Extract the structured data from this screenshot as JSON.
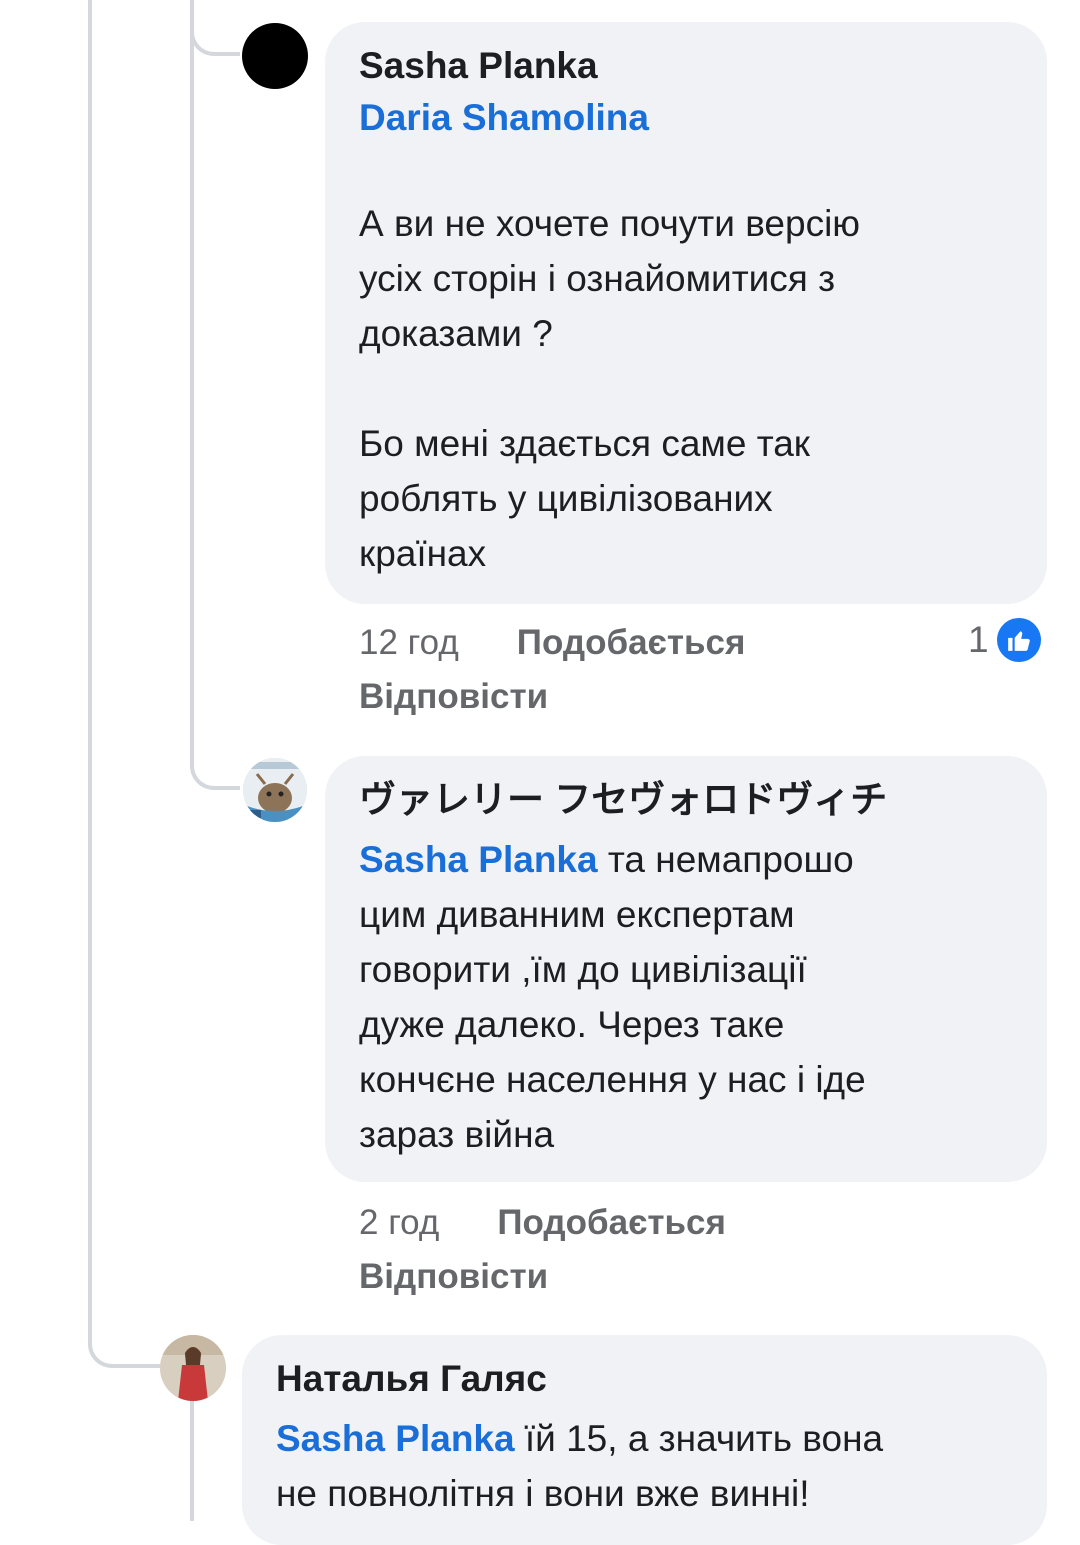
{
  "comments": [
    {
      "author": "Sasha Planka",
      "tag": "Daria Shamolina",
      "paragraph1": "А ви не хочете почути версію\nусіх сторін і ознайомитися з\nдоказами ?",
      "paragraph2": "Бо мені здається саме так\nроблять у цивілізованих\nкраїнах",
      "time": "12 год",
      "like_label": "Подобається",
      "reply_label": "Відповісти",
      "reaction_count": "1",
      "reaction_icon": "thumbs-up-icon",
      "reaction_color": "#1877f2"
    },
    {
      "author": "ヴァレリー フセヴォロドヴィチ",
      "mention": "Sasha Planka",
      "text_first": " та немапрошо",
      "text_rest": "цим диванним експертам\nговорити ,їм до цивілізації\nдуже далеко. Через таке\nкончєне населення у нас і іде\nзараз війна",
      "time": "2 год",
      "like_label": "Подобається",
      "reply_label": "Відповісти"
    },
    {
      "author": "Наталья Галяс",
      "mention": "Sasha Planka",
      "text_first": " їй 15, а значить вона",
      "text_rest": "не повнолітня і вони вже винні!"
    }
  ],
  "colors": {
    "mention": "#1a6ed8",
    "bubble": "#f0f2f5",
    "meta": "#65676b",
    "thread_line": "#d4d7db"
  }
}
